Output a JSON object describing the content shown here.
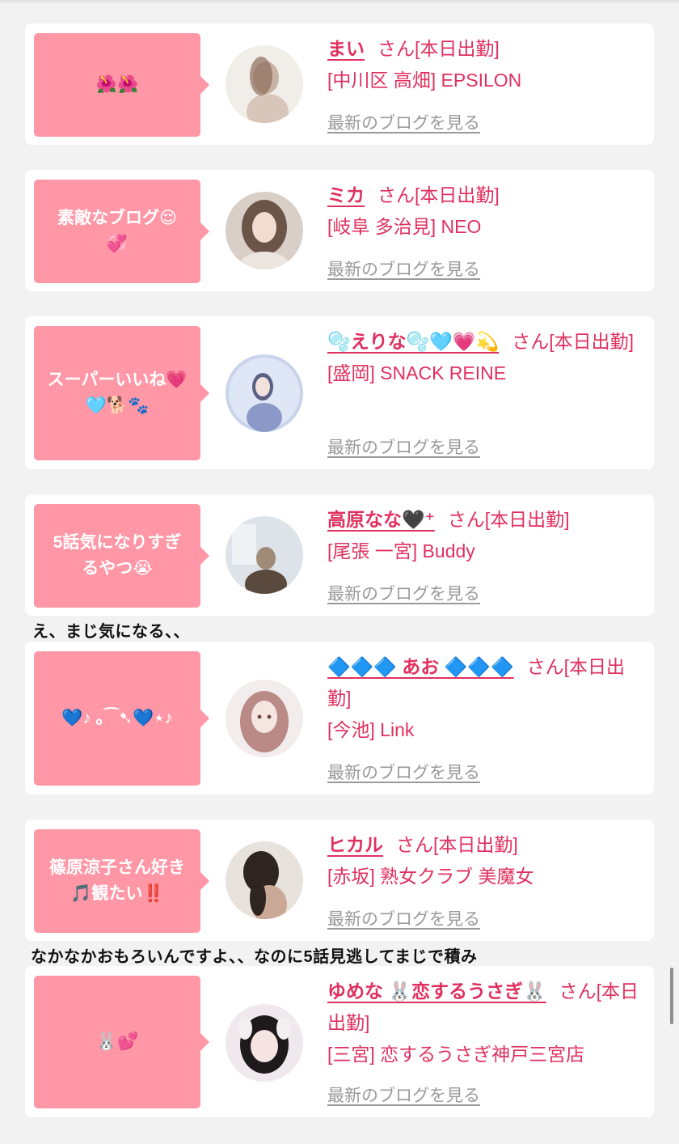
{
  "cards": [
    {
      "bubble": [
        "🌺🌺"
      ],
      "name": "まい",
      "san": "さん[本日出勤]",
      "shop": "[中川区 高畑] EPSILON",
      "blog_link": "最新のブログを見る",
      "avatar_colors": [
        "#f1ede8",
        "#c9b3a4",
        "#8d6e5c"
      ]
    },
    {
      "bubble": [
        "素敵なブログ😌",
        "💞"
      ],
      "name": "ミカ",
      "san": "さん[本日出勤]",
      "shop": "[岐阜 多治見] NEO",
      "blog_link": "最新のブログを見る",
      "avatar_colors": [
        "#d9cfc7",
        "#6b5548",
        "#2f2622"
      ]
    },
    {
      "bubble": [
        "スーパーいいね💗",
        "🩵🐕🐾"
      ],
      "name": "🫧えりな🫧🩵💗💫",
      "san": "さん[本日出勤]",
      "shop": "[盛岡] SNACK REINE",
      "blog_link": "最新のブログを見る",
      "avatar_colors": [
        "#c9d4ec",
        "#8c99c8",
        "#5a5f84"
      ]
    },
    {
      "bubble": [
        "5話気になりすぎ",
        "るやつ😭"
      ],
      "name": "高原なな🖤⁺",
      "san": "さん[本日出勤]",
      "shop": "[尾張 一宮] Buddy",
      "blog_link": "最新のブログを見る",
      "avatar_colors": [
        "#dde3e8",
        "#a08a78",
        "#5a4a3e"
      ]
    },
    {
      "bubble": [
        "💙♪ ｡⁀➷💙⋆♪"
      ],
      "name": "🔷🔷🔷 あお 🔷🔷🔷",
      "san": "さん[本日出勤]",
      "shop": "[今池] Link",
      "blog_link": "最新のブログを見る",
      "avatar_colors": [
        "#f3ecec",
        "#b98a86",
        "#6e4a48"
      ]
    },
    {
      "bubble": [
        "篠原涼子さん好き",
        "🎵観たい‼️"
      ],
      "name": "ヒカル",
      "san": "さん[本日出勤]",
      "shop": "[赤坂] 熟女クラブ 美魔女",
      "blog_link": "最新のブログを見る",
      "avatar_colors": [
        "#e8e2dc",
        "#7a6256",
        "#2e2420"
      ]
    },
    {
      "bubble": [
        "🐰💕"
      ],
      "name": "ゆめな 🐰恋するうさぎ🐰",
      "san": "さん[本日出勤]",
      "shop": "[三宮] 恋するうさぎ神戸三宮店",
      "blog_link": "最新のブログを見る",
      "avatar_colors": [
        "#efe8ec",
        "#3b3236",
        "#1e1a1c"
      ]
    }
  ],
  "captions": {
    "after_card_4": "え、まじ気になる、、",
    "after_card_6": "なかなかおもろいんですよ、、なのに5話見逃してまじで積み"
  }
}
